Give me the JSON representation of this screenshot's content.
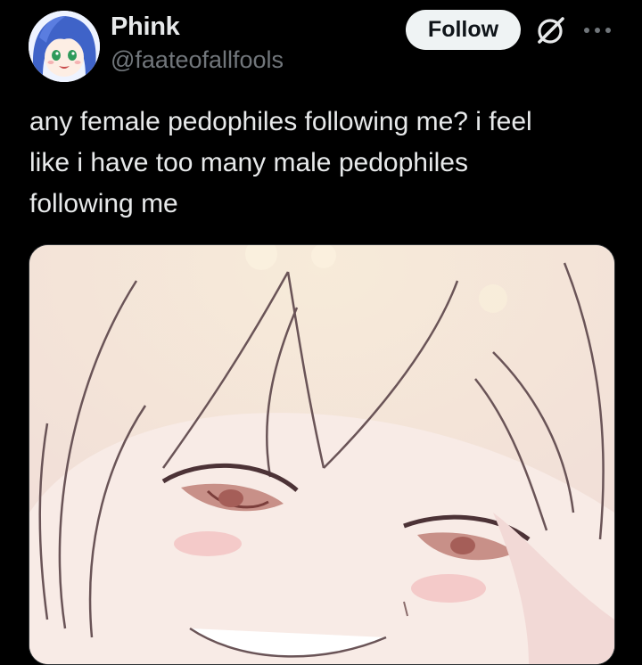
{
  "post": {
    "author": {
      "display_name": "Phink",
      "handle": "@faateofallfools"
    },
    "follow_label": "Follow",
    "text": "any female pedophiles following me? i feel\nlike i have too many male pedophiles\nfollowing me"
  },
  "icons": {
    "grok": "grok-icon",
    "more": "more-options-icon"
  },
  "colors": {
    "background": "#000000",
    "primary_text": "#e7e9ea",
    "secondary_text": "#71767b",
    "follow_button_bg": "#eff3f4",
    "follow_button_text": "#0f1419"
  }
}
